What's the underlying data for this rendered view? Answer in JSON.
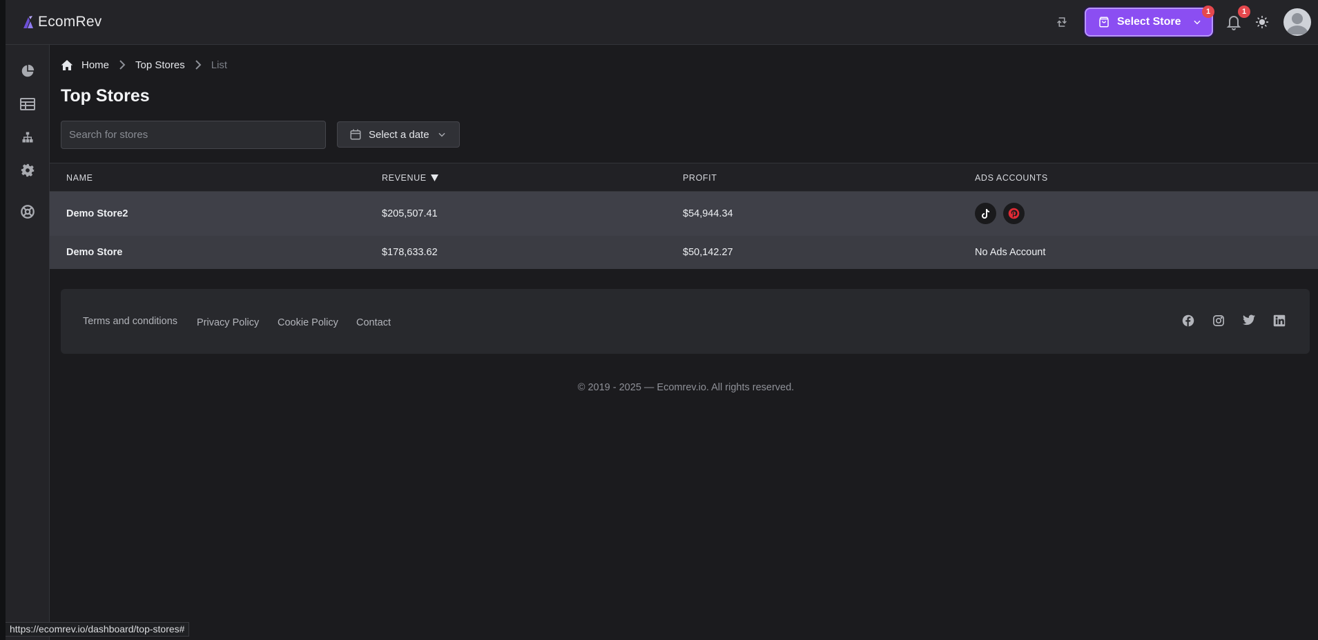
{
  "app": {
    "name": "EcomRev",
    "accent_color": "#8b4ef2"
  },
  "header": {
    "store_button_label": "Select Store",
    "store_badge": "1",
    "notifications_badge": "1",
    "icons": [
      "sync-icon",
      "store-bag-icon",
      "chevron-down-icon",
      "bell-icon",
      "sun-icon",
      "avatar"
    ]
  },
  "sidebar": {
    "items": [
      {
        "icon": "pie-chart-icon"
      },
      {
        "icon": "table-icon"
      },
      {
        "icon": "hierarchy-icon"
      },
      {
        "icon": "gear-icon"
      },
      {
        "icon": "support-icon"
      }
    ]
  },
  "breadcrumb": {
    "home": "Home",
    "section": "Top Stores",
    "current": "List"
  },
  "page": {
    "title": "Top Stores",
    "search_placeholder": "Search for stores",
    "date_button": "Select a date"
  },
  "table": {
    "headers": {
      "name": "NAME",
      "revenue": "REVENUE",
      "profit": "PROFIT",
      "ads": "ADS ACCOUNTS"
    },
    "sort": "revenue descending",
    "rows": [
      {
        "name": "Demo Store2",
        "revenue": "$205,507.41",
        "profit": "$54,944.34",
        "ads": [
          "tiktok-icon",
          "pinterest-icon"
        ]
      },
      {
        "name": "Demo Store",
        "revenue": "$178,633.62",
        "profit": "$50,142.27",
        "ads_text": "No Ads Account"
      }
    ]
  },
  "footer": {
    "links": [
      "Terms and conditions",
      "Privacy Policy",
      "Cookie Policy",
      "Contact"
    ],
    "social": [
      "facebook-icon",
      "instagram-icon",
      "twitter-icon",
      "linkedin-icon"
    ],
    "copyright": "© 2019 - 2025 — Ecomrev.io. All rights reserved."
  },
  "status_url": "https://ecomrev.io/dashboard/top-stores#"
}
